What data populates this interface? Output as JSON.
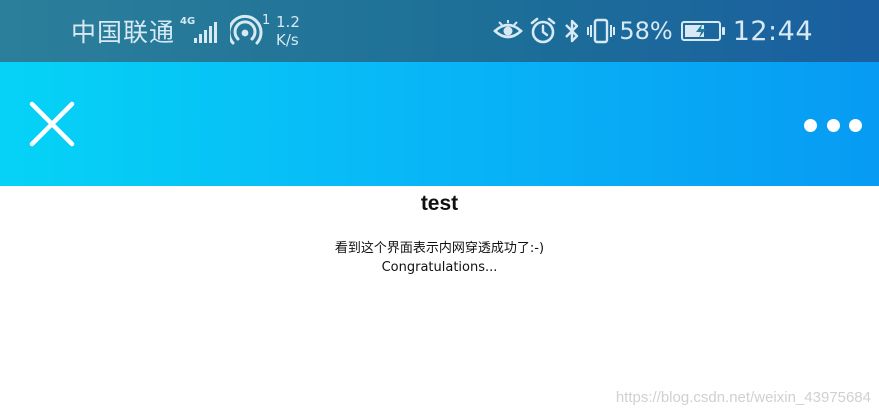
{
  "status_bar": {
    "carrier": "中国联通",
    "network_type": "4G",
    "hotspot_count": "1",
    "speed_value": "1.2",
    "speed_unit": "K/s",
    "battery_percent": "58%",
    "battery_level": 0.58,
    "time": "12:44",
    "icons": [
      "signal-icon",
      "hotspot-icon",
      "eye-icon",
      "alarm-icon",
      "bluetooth-icon",
      "vibrate-icon",
      "battery-icon"
    ]
  },
  "header": {
    "close_icon": "close-icon",
    "more_icon": "more-icon",
    "background_colors": [
      "#05d3f6",
      "#079bf3"
    ]
  },
  "page": {
    "title": "test",
    "message_line1": "看到这个界面表示内网穿透成功了:-)",
    "message_line2": "Congratulations..."
  },
  "watermark": "https://blog.csdn.net/weixin_43975684"
}
